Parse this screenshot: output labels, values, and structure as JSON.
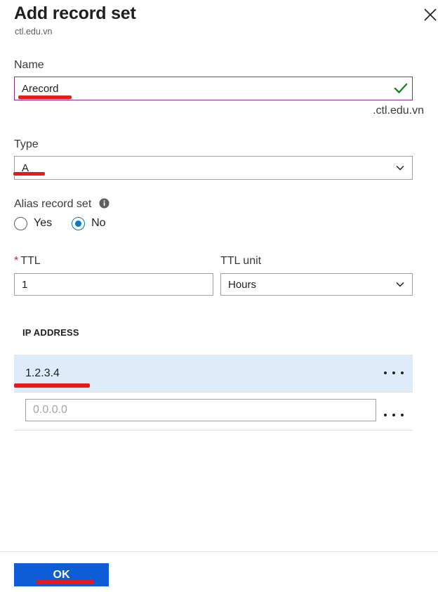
{
  "header": {
    "title": "Add record set",
    "subtitle": "ctl.edu.vn",
    "close_icon": "close-icon"
  },
  "form": {
    "name": {
      "label": "Name",
      "value": "Arecord",
      "placeholder": "",
      "suffix": ".ctl.edu.vn",
      "valid_icon": "checkmark-icon",
      "valid_color": "#107c10",
      "border_color": "#8a2f8a"
    },
    "type": {
      "label": "Type",
      "value": "A",
      "chevron_icon": "chevron-down-icon",
      "options": [
        "A"
      ]
    },
    "alias": {
      "label": "Alias record set",
      "info_icon": "info-icon",
      "options": [
        {
          "label": "Yes",
          "selected": false
        },
        {
          "label": "No",
          "selected": true
        }
      ],
      "accent": "#0078d4"
    },
    "ttl": {
      "label": "TTL",
      "required": true,
      "required_mark": "*",
      "value": "1"
    },
    "ttl_unit": {
      "label": "TTL unit",
      "value": "Hours",
      "chevron_icon": "chevron-down-icon",
      "options": [
        "Hours"
      ]
    },
    "ip_section": {
      "caption": "IP ADDRESS",
      "rows": [
        {
          "value": "1.2.3.4",
          "placeholder": "",
          "selected": true,
          "menu_icon": "ellipsis-icon"
        },
        {
          "value": "",
          "placeholder": "0.0.0.0",
          "selected": false,
          "menu_icon": "ellipsis-icon"
        }
      ],
      "selected_row_color": "#deecf9"
    }
  },
  "footer": {
    "ok_label": "OK",
    "ok_color": "#0f5dd6"
  },
  "annotations": {
    "color": "#e81919",
    "marks": [
      "name-underline",
      "type-underline",
      "ip-underline",
      "ok-underline"
    ]
  }
}
